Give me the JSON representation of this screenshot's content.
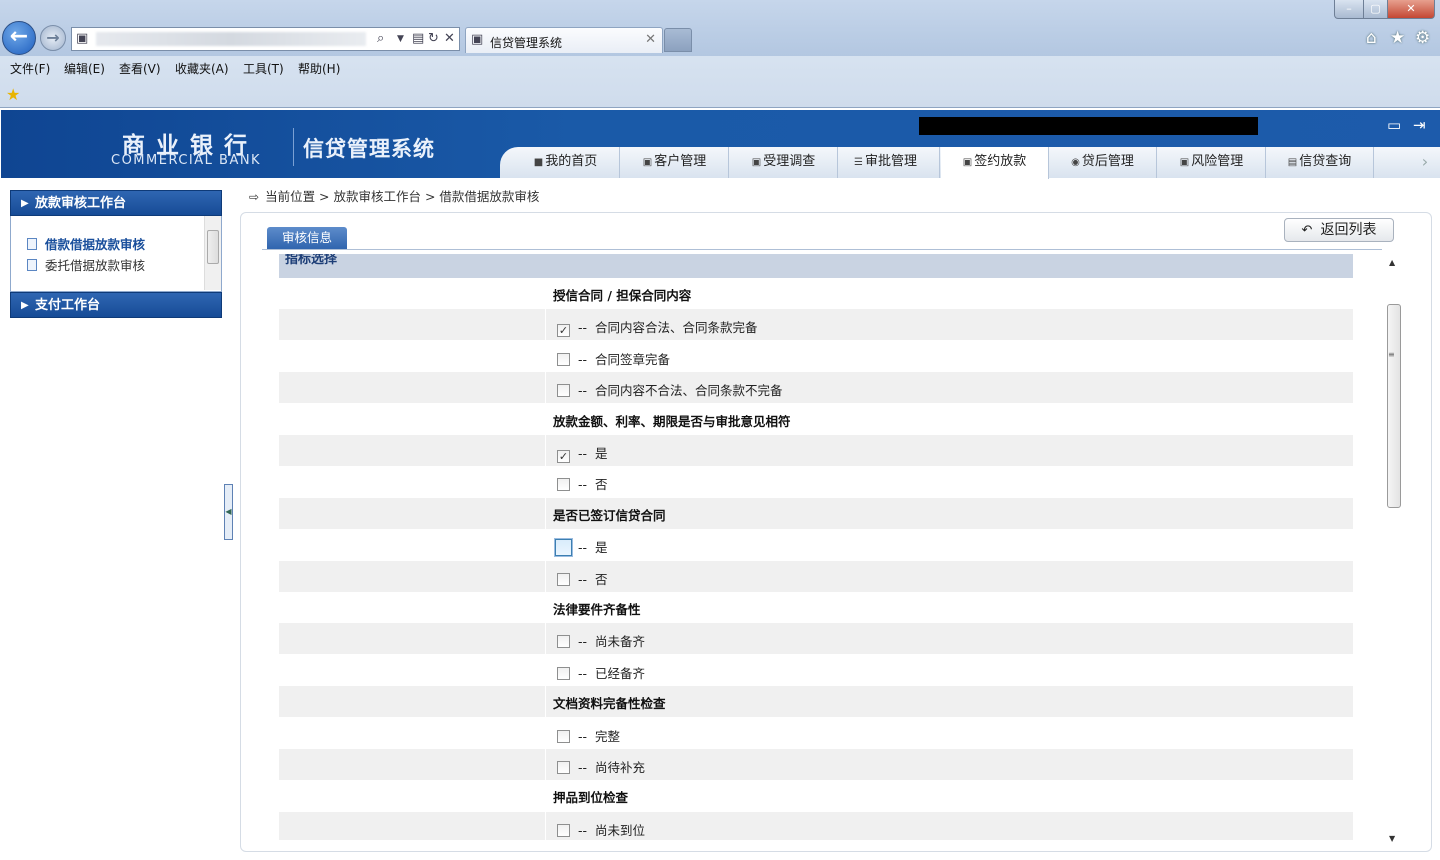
{
  "browser": {
    "tab_title": "信贷管理系统",
    "menu": [
      "文件(F)",
      "编辑(E)",
      "查看(V)",
      "收藏夹(A)",
      "工具(T)",
      "帮助(H)"
    ]
  },
  "app": {
    "logo_cn": "商业银行",
    "logo_en": "COMMERCIAL BANK",
    "system_name": "信贷管理系统"
  },
  "nav": {
    "tabs": [
      {
        "label": "我的首页",
        "icon": "home-icon"
      },
      {
        "label": "客户管理",
        "icon": "customer-icon"
      },
      {
        "label": "受理调查",
        "icon": "survey-icon"
      },
      {
        "label": "审批管理",
        "icon": "approval-icon"
      },
      {
        "label": "签约放款",
        "icon": "contract-icon",
        "active": true
      },
      {
        "label": "贷后管理",
        "icon": "post-loan-icon"
      },
      {
        "label": "风险管理",
        "icon": "risk-icon"
      },
      {
        "label": "信贷查询",
        "icon": "query-icon"
      }
    ]
  },
  "sidebar": {
    "section1": "放款审核工作台",
    "items": [
      "借款借据放款审核",
      "委托借据放款审核"
    ],
    "section2": "支付工作台"
  },
  "breadcrumb": "当前位置 > 放款审核工作台 > 借款借据放款审核",
  "tab_audit": "审核信息",
  "return_label": "返回列表",
  "section_title": "指标选择",
  "option_prefix": "--",
  "groups": [
    {
      "title": "授信合同 / 担保合同内容",
      "options": [
        {
          "label": "合同内容合法、合同条款完备",
          "checked": true
        },
        {
          "label": "合同签章完备",
          "checked": false
        },
        {
          "label": "合同内容不合法、合同条款不完备",
          "checked": false
        }
      ]
    },
    {
      "title": "放款金额、利率、期限是否与审批意见相符",
      "options": [
        {
          "label": "是",
          "checked": true
        },
        {
          "label": "否",
          "checked": false
        }
      ]
    },
    {
      "title": "是否已签订信贷合同",
      "options": [
        {
          "label": "是",
          "checked": false,
          "focused": true
        },
        {
          "label": "否",
          "checked": false
        }
      ]
    },
    {
      "title": "法律要件齐备性",
      "options": [
        {
          "label": "尚未备齐",
          "checked": false
        },
        {
          "label": "已经备齐",
          "checked": false
        }
      ]
    },
    {
      "title": "文档资料完备性检查",
      "options": [
        {
          "label": "完整",
          "checked": false
        },
        {
          "label": "尚待补充",
          "checked": false
        }
      ]
    },
    {
      "title": "押品到位检查",
      "options": [
        {
          "label": "尚未到位",
          "checked": false
        }
      ]
    }
  ]
}
